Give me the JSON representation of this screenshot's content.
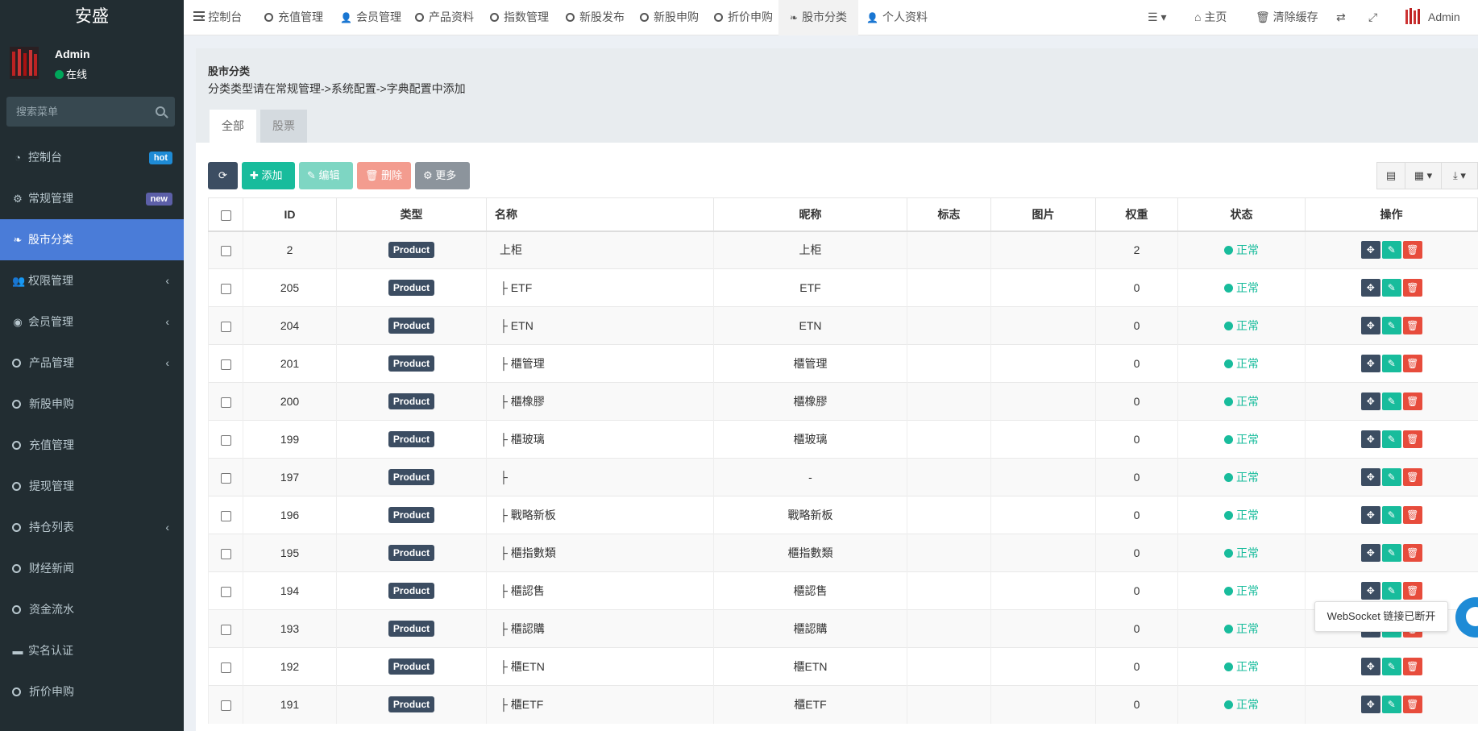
{
  "sidebar": {
    "brand": "安盛",
    "user": {
      "name": "Admin",
      "status": "在线"
    },
    "search_placeholder": "搜索菜单",
    "items": [
      {
        "label": "控制台",
        "icon": "dashboard-icon",
        "badge": "hot"
      },
      {
        "label": "常规管理",
        "icon": "cogs-icon",
        "badge": "new"
      },
      {
        "label": "股市分类",
        "icon": "leaf-icon",
        "active": true
      },
      {
        "label": "权限管理",
        "icon": "group-icon",
        "chevron": true
      },
      {
        "label": "会员管理",
        "icon": "user-circle-icon",
        "chevron": true
      },
      {
        "label": "产品管理",
        "icon": "circle-icon",
        "chevron": true
      },
      {
        "label": "新股申购",
        "icon": "circle-icon"
      },
      {
        "label": "充值管理",
        "icon": "circle-icon"
      },
      {
        "label": "提现管理",
        "icon": "circle-icon"
      },
      {
        "label": "持仓列表",
        "icon": "circle-icon",
        "chevron": true
      },
      {
        "label": "财经新闻",
        "icon": "circle-icon"
      },
      {
        "label": "资金流水",
        "icon": "circle-icon"
      },
      {
        "label": "实名认证",
        "icon": "credit-card-icon"
      },
      {
        "label": "折价申购",
        "icon": "circle-icon"
      }
    ]
  },
  "topnav": {
    "tabs": [
      "控制台",
      "充值管理",
      "会员管理",
      "产品资料",
      "指数管理",
      "新股发布",
      "新股申购",
      "折价申购",
      "股市分类",
      "个人资料"
    ],
    "active_tab": "股市分类",
    "home": "主页",
    "clear_cache": "清除缓存",
    "admin": "Admin"
  },
  "content": {
    "title": "股市分类",
    "subtitle": "分类类型请在常规管理->系统配置->字典配置中添加",
    "tabs": [
      "全部",
      "股票"
    ]
  },
  "toolbar": {
    "add": "添加",
    "edit": "编辑",
    "delete": "删除",
    "more": "更多"
  },
  "table": {
    "headers": [
      "ID",
      "类型",
      "名称",
      "昵称",
      "标志",
      "图片",
      "权重",
      "状态",
      "操作"
    ],
    "type_badge": "Product",
    "status_label": "正常",
    "rows": [
      {
        "id": "2",
        "name": "上柜",
        "nickname": "上柜",
        "weight": "2"
      },
      {
        "id": "205",
        "name": "├ ETF",
        "nickname": "ETF",
        "weight": "0"
      },
      {
        "id": "204",
        "name": "├ ETN",
        "nickname": "ETN",
        "weight": "0"
      },
      {
        "id": "201",
        "name": "├ 櫃管理",
        "nickname": "櫃管理",
        "weight": "0"
      },
      {
        "id": "200",
        "name": "├ 櫃橡膠",
        "nickname": "櫃橡膠",
        "weight": "0"
      },
      {
        "id": "199",
        "name": "├ 櫃玻璃",
        "nickname": "櫃玻璃",
        "weight": "0"
      },
      {
        "id": "197",
        "name": "├",
        "nickname": "-",
        "weight": "0"
      },
      {
        "id": "196",
        "name": "├ 戰略新板",
        "nickname": "戰略新板",
        "weight": "0"
      },
      {
        "id": "195",
        "name": "├ 櫃指數類",
        "nickname": "櫃指數類",
        "weight": "0"
      },
      {
        "id": "194",
        "name": "├ 櫃認售",
        "nickname": "櫃認售",
        "weight": "0"
      },
      {
        "id": "193",
        "name": "├ 櫃認購",
        "nickname": "櫃認購",
        "weight": "0"
      },
      {
        "id": "192",
        "name": "├ 櫃ETN",
        "nickname": "櫃ETN",
        "weight": "0"
      },
      {
        "id": "191",
        "name": "├ 櫃ETF",
        "nickname": "櫃ETF",
        "weight": "0"
      }
    ]
  },
  "toast": "WebSocket 链接已断开"
}
